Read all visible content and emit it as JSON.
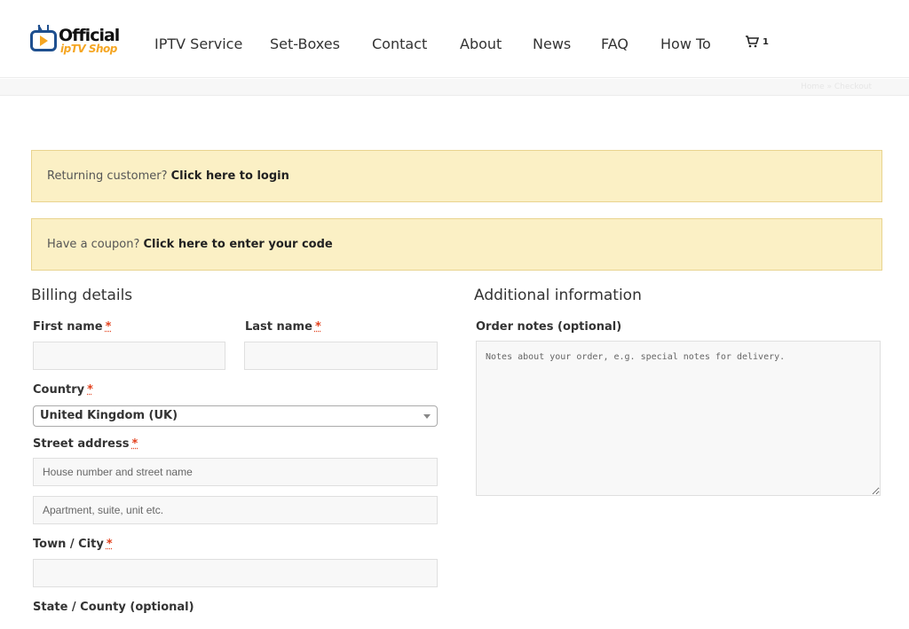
{
  "brand": {
    "line1": "Official",
    "line2": "ipTV Shop"
  },
  "nav": {
    "items": [
      "IPTV Service",
      "Set-Boxes",
      "Contact",
      "About",
      "News",
      "FAQ",
      "How To"
    ],
    "cart_count": "1"
  },
  "breadcrumb": "Home » Checkout",
  "notices": {
    "login_prefix": "Returning customer?",
    "login_link": "Click here to login",
    "coupon_prefix": "Have a coupon?",
    "coupon_link": "Click here to enter your code"
  },
  "billing": {
    "heading": "Billing details",
    "first_name": "First name",
    "last_name": "Last name",
    "country": "Country",
    "country_value": "United Kingdom (UK)",
    "street": "Street address",
    "street_placeholder": "House number and street name",
    "apartment_placeholder": "Apartment, suite, unit etc.",
    "town": "Town / City",
    "state": "State / County (optional)",
    "required_mark": "*"
  },
  "additional": {
    "heading": "Additional information",
    "order_notes": "Order notes (optional)",
    "order_notes_placeholder": "Notes about your order, e.g. special notes for delivery."
  },
  "colors": {
    "notice_bg": "#fbf0c5",
    "logo_blue": "#1e4f8f",
    "logo_orange": "#f5a623",
    "required": "#e2401c"
  },
  "icons": [
    "tv-logo-icon",
    "cart-icon",
    "chevron-down-icon"
  ]
}
